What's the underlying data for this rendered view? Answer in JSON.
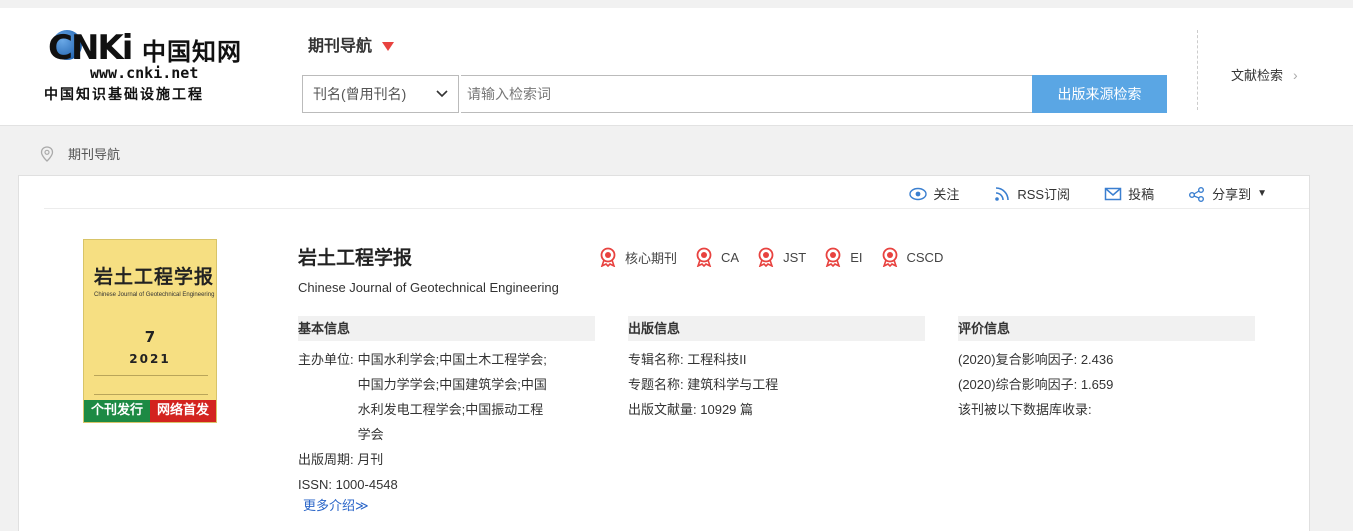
{
  "header": {
    "logo_mark": "CNKi",
    "logo_cn": "中国知网",
    "logo_url": "www.cnki.net",
    "logo_sub": "中国知识基础设施工程",
    "nav_title": "期刊导航",
    "search": {
      "select_value": "刊名(曾用刊名)",
      "placeholder": "请输入检索词",
      "button_label": "出版来源检索"
    },
    "doc_search_label": "文献检索",
    "doc_search_chevron": "›"
  },
  "breadcrumb": {
    "label": "期刊导航"
  },
  "toolbar": {
    "follow": "关注",
    "rss": "RSS订阅",
    "submit": "投稿",
    "share": "分享到"
  },
  "journal": {
    "title": "岩土工程学报",
    "english_title": "Chinese Journal of Geotechnical Engineering",
    "badges": [
      "核心期刊",
      "CA",
      "JST",
      "EI",
      "CSCD"
    ],
    "cover": {
      "title": "岩土工程学报",
      "english": "Chinese Journal of Geotechnical Engineering",
      "issue": "7",
      "year": "2021",
      "left_tag": "个刊发行",
      "right_tag": "网络首发"
    },
    "basic": {
      "heading": "基本信息",
      "sponsor_label": "主办单位:",
      "sponsor_lines": [
        "中国水利学会;中国土木工程学会;",
        "中国力学学会;中国建筑学会;中国",
        "水利发电工程学会;中国振动工程",
        "学会"
      ],
      "period_label": "出版周期:",
      "period_value": "月刊",
      "issn_label": "ISSN:",
      "issn_value": "1000-4548",
      "more": "更多介绍≫"
    },
    "publish": {
      "heading": "出版信息",
      "album_label": "专辑名称:",
      "album_value": "工程科技II",
      "topic_label": "专题名称:",
      "topic_value": "建筑科学与工程",
      "count_label": "出版文献量:",
      "count_value": "10929 篇"
    },
    "evaluation": {
      "heading": "评价信息",
      "compound_label": "(2020)复合影响因子:",
      "compound_value": "2.436",
      "overall_label": "(2020)综合影响因子:",
      "overall_value": "1.659",
      "db_label": "该刊被以下数据库收录:"
    }
  },
  "colors": {
    "accent": "#5aa6e4",
    "badge": "#e8423f",
    "link": "#2a65c8"
  }
}
